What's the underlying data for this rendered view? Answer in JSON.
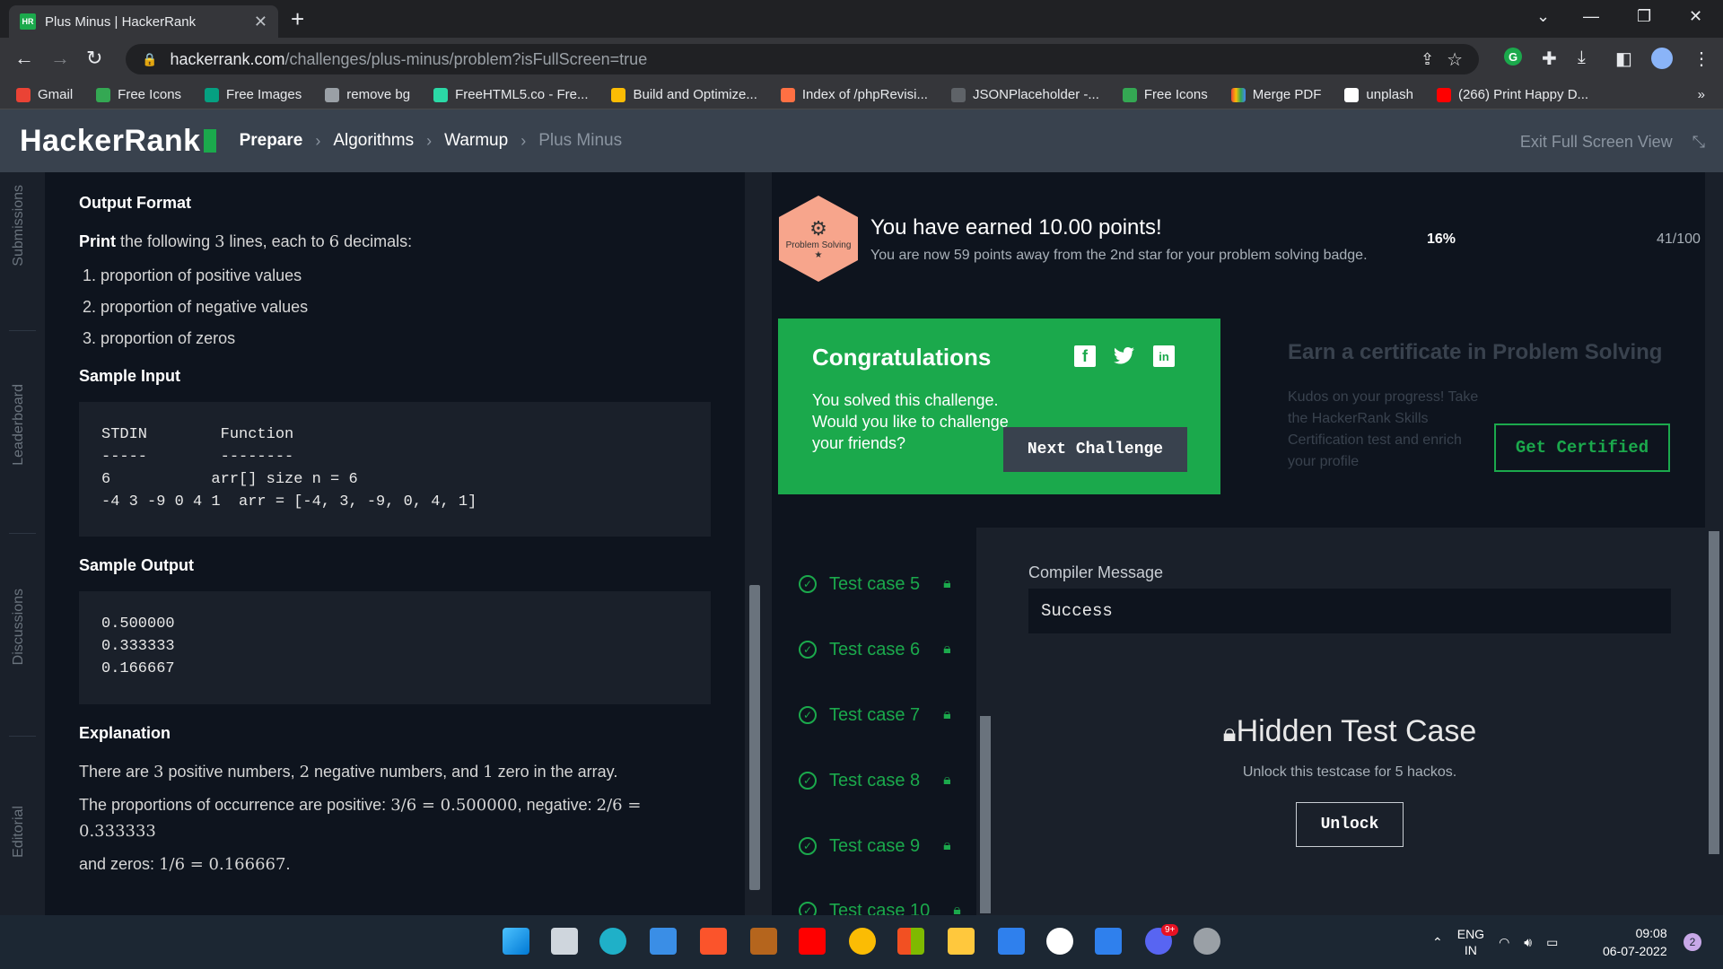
{
  "browser": {
    "tab_title": "Plus Minus | HackerRank",
    "tab_favicon": "HR",
    "url_domain": "hackerrank.com",
    "url_path": "/challenges/plus-minus/problem?isFullScreen=true",
    "bookmarks": [
      "Gmail",
      "Free Icons",
      "Free Images",
      "remove bg",
      "FreeHTML5.co - Fre...",
      "Build and Optimize...",
      "Index of /phpRevisi...",
      "JSONPlaceholder -...",
      "Free Icons",
      "Merge PDF",
      "unplash",
      "(266) Print Happy D..."
    ]
  },
  "header": {
    "logo": "HackerRank",
    "breadcrumb": [
      "Prepare",
      "Algorithms",
      "Warmup",
      "Plus Minus"
    ],
    "exit_fullscreen": "Exit Full Screen View"
  },
  "sidenav": [
    "Submissions",
    "Leaderboard",
    "Discussions",
    "Editorial"
  ],
  "problem": {
    "output_format_title": "Output Format",
    "print_word": "Print",
    "print_rest_1": " the following ",
    "print_num_lines": "3",
    "print_rest_2": " lines, each to ",
    "print_num_dec": "6",
    "print_rest_3": " decimals:",
    "output_items": [
      "proportion of positive values",
      "proportion of negative values",
      "proportion of zeros"
    ],
    "sample_input_title": "Sample Input",
    "sample_input": "STDIN        Function\n-----        --------\n6           arr[] size n = 6\n-4 3 -9 0 4 1  arr = [-4, 3, -9, 0, 4, 1]",
    "sample_output_title": "Sample Output",
    "sample_output": "0.500000\n0.333333\n0.166667",
    "explanation_title": "Explanation",
    "exp_1a": "There are ",
    "exp_1b": "3",
    "exp_1c": " positive numbers, ",
    "exp_1d": "2",
    "exp_1e": " negative numbers, and ",
    "exp_1f": "1",
    "exp_1g": " zero in the array.",
    "exp_2a": "The proportions of occurrence are positive: ",
    "exp_2b": "3/6 = 0.500000",
    "exp_2c": ", negative: ",
    "exp_2d": "2/6 = 0.333333",
    "exp_3a": "and zeros: ",
    "exp_3b": "1/6 = 0.166667",
    "exp_3c": "."
  },
  "points": {
    "badge_label": "Problem Solving",
    "title": "You have earned 10.00 points!",
    "subtitle": "You are now 59 points away from the 2nd star for your problem solving badge.",
    "percent": "16%",
    "progress": "41/100"
  },
  "congrats": {
    "title": "Congratulations",
    "body": "You solved this challenge. Would you like to challenge your friends?",
    "next_button": "Next Challenge",
    "facebook": "f",
    "linkedin": "in"
  },
  "certificate": {
    "title": "Earn a certificate in Problem Solving",
    "body": "Kudos on your progress! Take the HackerRank Skills Certification test and enrich your profile",
    "button": "Get Certified"
  },
  "testcases": [
    "Test case 5",
    "Test case 6",
    "Test case 7",
    "Test case 8",
    "Test case 9",
    "Test case 10"
  ],
  "output": {
    "compiler_label": "Compiler Message",
    "compiler_value": "Success",
    "hidden_title": "Hidden Test Case",
    "hidden_sub": "Unlock this testcase for 5 hackos.",
    "unlock_button": "Unlock"
  },
  "taskbar": {
    "lang": "ENG",
    "region": "IN",
    "time": "09:08",
    "date": "06-07-2022",
    "notifications": "2",
    "discord_badge": "9+"
  }
}
